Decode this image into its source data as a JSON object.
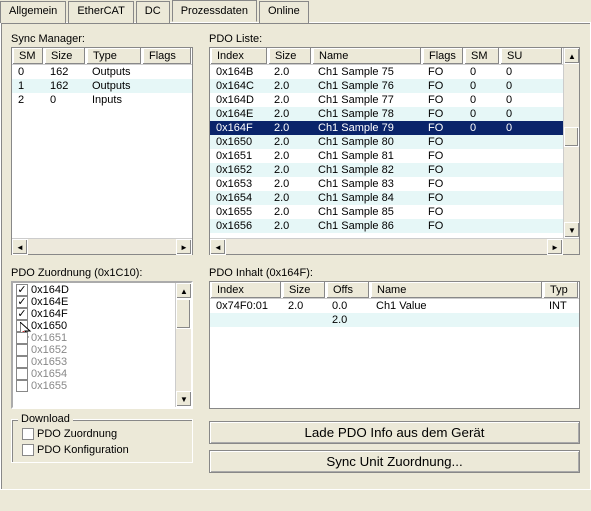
{
  "tabs": [
    "Allgemein",
    "EtherCAT",
    "DC",
    "Prozessdaten",
    "Online"
  ],
  "activeTab": 3,
  "syncManager": {
    "label": "Sync Manager:",
    "headers": [
      "SM",
      "Size",
      "Type",
      "Flags"
    ],
    "rows": [
      {
        "sm": "0",
        "size": "162",
        "type": "Outputs",
        "flags": ""
      },
      {
        "sm": "1",
        "size": "162",
        "type": "Outputs",
        "flags": ""
      },
      {
        "sm": "2",
        "size": "0",
        "type": "Inputs",
        "flags": ""
      }
    ]
  },
  "pdoListe": {
    "label": "PDO Liste:",
    "headers": [
      "Index",
      "Size",
      "Name",
      "Flags",
      "SM",
      "SU"
    ],
    "rows": [
      {
        "index": "0x164B",
        "size": "2.0",
        "name": "Ch1 Sample 75",
        "flags": "FO",
        "sm": "0",
        "su": "0",
        "sel": false
      },
      {
        "index": "0x164C",
        "size": "2.0",
        "name": "Ch1 Sample 76",
        "flags": "FO",
        "sm": "0",
        "su": "0",
        "sel": false
      },
      {
        "index": "0x164D",
        "size": "2.0",
        "name": "Ch1 Sample 77",
        "flags": "FO",
        "sm": "0",
        "su": "0",
        "sel": false
      },
      {
        "index": "0x164E",
        "size": "2.0",
        "name": "Ch1 Sample 78",
        "flags": "FO",
        "sm": "0",
        "su": "0",
        "sel": false
      },
      {
        "index": "0x164F",
        "size": "2.0",
        "name": "Ch1 Sample 79",
        "flags": "FO",
        "sm": "0",
        "su": "0",
        "sel": true
      },
      {
        "index": "0x1650",
        "size": "2.0",
        "name": "Ch1 Sample 80",
        "flags": "FO",
        "sm": "",
        "su": "",
        "sel": false
      },
      {
        "index": "0x1651",
        "size": "2.0",
        "name": "Ch1 Sample 81",
        "flags": "FO",
        "sm": "",
        "su": "",
        "sel": false
      },
      {
        "index": "0x1652",
        "size": "2.0",
        "name": "Ch1 Sample 82",
        "flags": "FO",
        "sm": "",
        "su": "",
        "sel": false
      },
      {
        "index": "0x1653",
        "size": "2.0",
        "name": "Ch1 Sample 83",
        "flags": "FO",
        "sm": "",
        "su": "",
        "sel": false
      },
      {
        "index": "0x1654",
        "size": "2.0",
        "name": "Ch1 Sample 84",
        "flags": "FO",
        "sm": "",
        "su": "",
        "sel": false
      },
      {
        "index": "0x1655",
        "size": "2.0",
        "name": "Ch1 Sample 85",
        "flags": "FO",
        "sm": "",
        "su": "",
        "sel": false
      },
      {
        "index": "0x1656",
        "size": "2.0",
        "name": "Ch1 Sample 86",
        "flags": "FO",
        "sm": "",
        "su": "",
        "sel": false
      }
    ]
  },
  "pdoZuordnung": {
    "label": "PDO Zuordnung (0x1C10):",
    "items": [
      {
        "text": "0x164D",
        "checked": true,
        "disabled": false
      },
      {
        "text": "0x164E",
        "checked": true,
        "disabled": false
      },
      {
        "text": "0x164F",
        "checked": true,
        "disabled": false
      },
      {
        "text": "0x1650",
        "checked": false,
        "disabled": false,
        "cursor": true
      },
      {
        "text": "0x1651",
        "checked": false,
        "disabled": true
      },
      {
        "text": "0x1652",
        "checked": false,
        "disabled": true
      },
      {
        "text": "0x1653",
        "checked": false,
        "disabled": true
      },
      {
        "text": "0x1654",
        "checked": false,
        "disabled": true
      },
      {
        "text": "0x1655",
        "checked": false,
        "disabled": true
      }
    ]
  },
  "pdoInhalt": {
    "label": "PDO Inhalt (0x164F):",
    "headers": [
      "Index",
      "Size",
      "Offs",
      "Name",
      "Typ"
    ],
    "rows": [
      {
        "index": "0x74F0:01",
        "size": "2.0",
        "offs": "0.0",
        "name": "Ch1 Value",
        "typ": "INT"
      },
      {
        "index": "",
        "size": "",
        "offs": "2.0",
        "name": "",
        "typ": ""
      }
    ]
  },
  "download": {
    "title": "Download",
    "items": [
      "PDO Zuordnung",
      "PDO Konfiguration"
    ]
  },
  "buttons": {
    "loadPdo": "Lade PDO Info aus dem Gerät",
    "syncUnit": "Sync Unit Zuordnung..."
  }
}
